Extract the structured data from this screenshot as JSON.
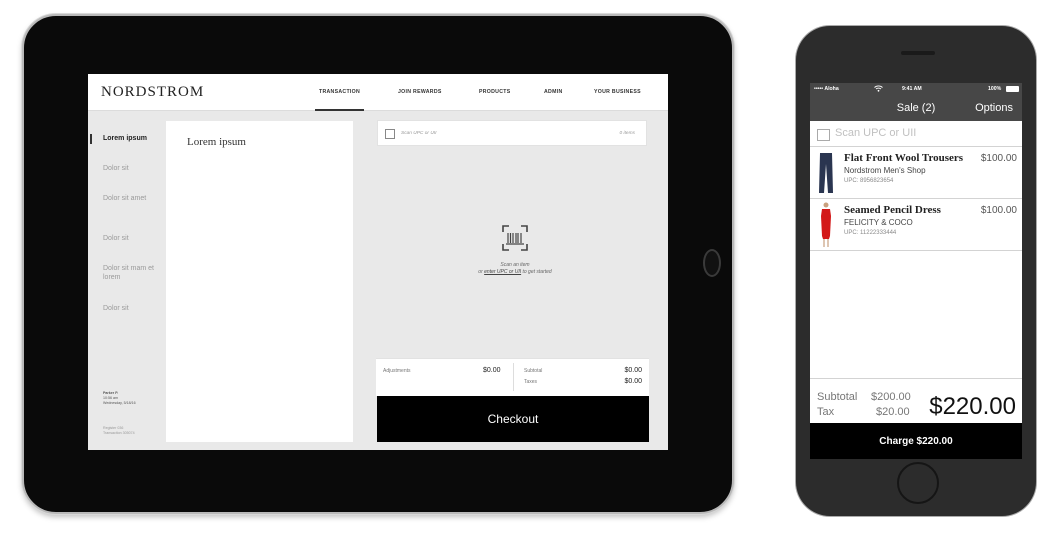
{
  "tablet": {
    "brand": "NORDSTROM",
    "nav": [
      "TRANSACTION",
      "JOIN REWARDS",
      "PRODUCTS",
      "ADMIN",
      "YOUR BUSINESS"
    ],
    "active_nav": "TRANSACTION",
    "sidebar": {
      "items": [
        {
          "label": "Lorem ipsum",
          "active": true
        },
        {
          "label": "Dolor sit"
        },
        {
          "label": "Dolor sit amet"
        },
        {
          "label": "Dolor sit"
        },
        {
          "label": "Dolor sit mam et lorem"
        },
        {
          "label": "Dolor sit"
        }
      ],
      "user_name": "Parker P.",
      "time": "10:56 am",
      "date": "Wednesday, 5/18/16",
      "register": "Register 036",
      "transaction": "Transaction 305074"
    },
    "panel_title": "Lorem ipsum",
    "scan": {
      "placeholder": "Scan UPC or UII",
      "count": "0 items"
    },
    "empty_state": {
      "line1": "Scan an item",
      "line2_prefix": "or ",
      "link": "enter UPC or UII",
      "line2_suffix": " to get started"
    },
    "totals": {
      "adjustments_label": "Adjustments",
      "adjustments_value": "$0.00",
      "subtotal_label": "Subtotal",
      "subtotal_value": "$0.00",
      "taxes_label": "Taxes",
      "taxes_value": "$0.00"
    },
    "checkout_label": "Checkout"
  },
  "phone": {
    "status": {
      "carrier": "••••• Aloha",
      "wifi": "wifi-icon",
      "time": "9:41 AM",
      "battery": "100%"
    },
    "header": {
      "title": "Sale (2)",
      "options": "Options"
    },
    "scan_placeholder": "Scan UPC or UII",
    "items": [
      {
        "name": "Flat Front Wool Trousers",
        "shop": "Nordstrom Men's Shop",
        "upc": "UPC: 8956823654",
        "price": "$100.00",
        "thumb_color": "#2a3550"
      },
      {
        "name": "Seamed Pencil Dress",
        "shop": "FELICITY & COCO",
        "upc": "UPC: 11222333444",
        "price": "$100.00",
        "thumb_color": "#d31818"
      }
    ],
    "summary": {
      "subtotal_label": "Subtotal",
      "subtotal_value": "$200.00",
      "tax_label": "Tax",
      "tax_value": "$20.00",
      "total": "$220.00"
    },
    "charge_label": "Charge $220.00"
  }
}
